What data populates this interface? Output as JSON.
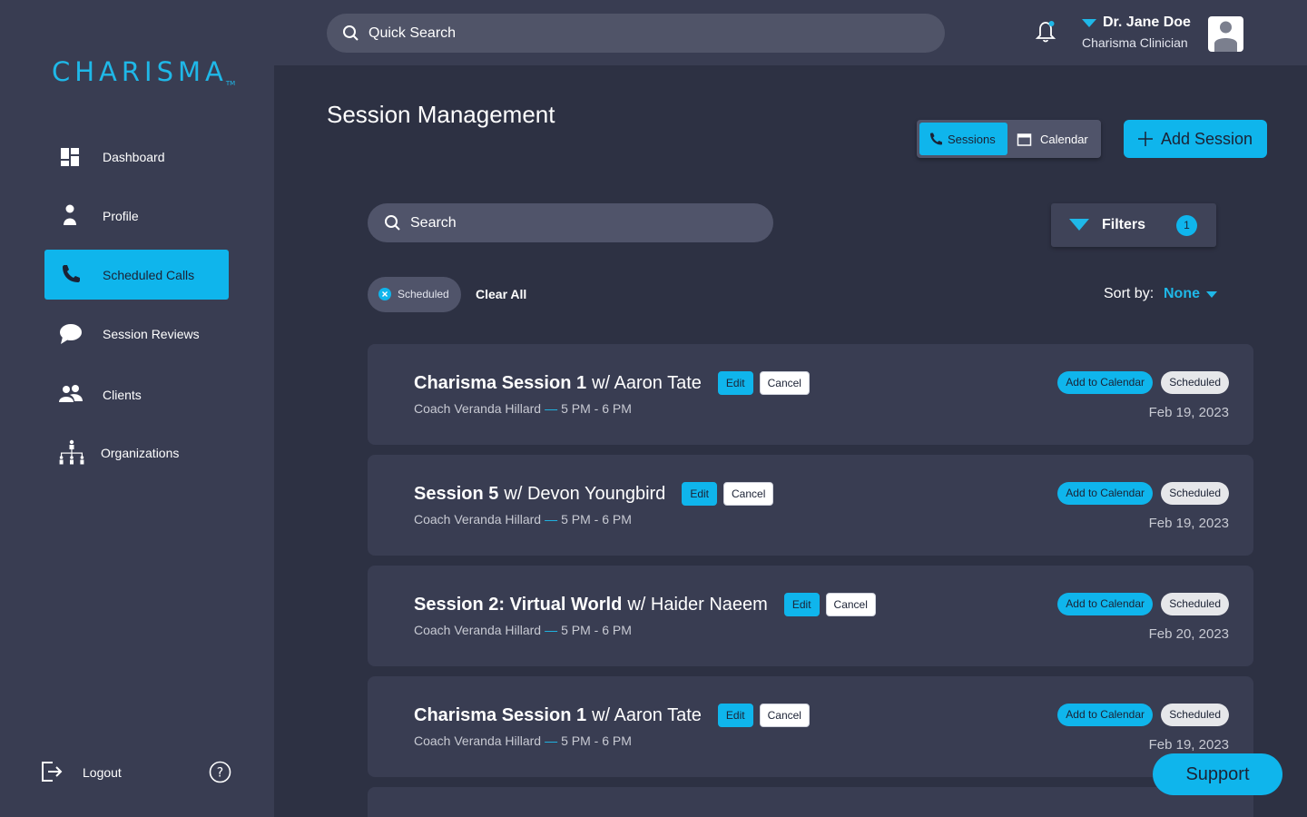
{
  "app": {
    "logo": "CHARISMA",
    "logo_tm": "TM"
  },
  "sidebar": {
    "items": [
      {
        "label": "Dashboard",
        "icon": "dashboard-icon"
      },
      {
        "label": "Profile",
        "icon": "person-icon"
      },
      {
        "label": "Scheduled Calls",
        "icon": "phone-icon",
        "active": true
      },
      {
        "label": "Session Reviews",
        "icon": "chat-bubble-icon"
      },
      {
        "label": "Clients",
        "icon": "group-icon"
      },
      {
        "label": "Organizations",
        "icon": "org-chart-icon"
      }
    ],
    "logout_label": "Logout",
    "help_icon": "question-icon"
  },
  "topbar": {
    "quick_search_placeholder": "Quick Search",
    "user_name": "Dr. Jane Doe",
    "user_role": "Charisma Clinician"
  },
  "main": {
    "title": "Session Management",
    "toggle": {
      "sessions_label": "Sessions",
      "calendar_label": "Calendar"
    },
    "add_session_label": "Add Session",
    "search_placeholder": "Search",
    "filters_label": "Filters",
    "filters_count": "1",
    "chips": [
      {
        "label": "Scheduled"
      }
    ],
    "clear_all_label": "Clear All",
    "sort_label": "Sort by:",
    "sort_value": "None"
  },
  "sessions": [
    {
      "title_bold": "Charisma Session 1",
      "title_with": "w/ Aaron Tate",
      "coach": "Coach Veranda Hillard",
      "dash": "—",
      "time": "5 PM - 6 PM",
      "edit": "Edit",
      "cancel": "Cancel",
      "add_cal": "Add to Calendar",
      "status": "Scheduled",
      "date": "Feb 19, 2023"
    },
    {
      "title_bold": "Session 5",
      "title_with": "w/ Devon Youngbird",
      "coach": "Coach Veranda Hillard",
      "dash": "—",
      "time": "5 PM - 6 PM",
      "edit": "Edit",
      "cancel": "Cancel",
      "add_cal": "Add to Calendar",
      "status": "Scheduled",
      "date": "Feb 19, 2023"
    },
    {
      "title_bold": "Session 2: Virtual World",
      "title_with": "w/ Haider Naeem",
      "coach": "Coach Veranda Hillard",
      "dash": "—",
      "time": "5 PM - 6 PM",
      "edit": "Edit",
      "cancel": "Cancel",
      "add_cal": "Add to Calendar",
      "status": "Scheduled",
      "date": "Feb 20, 2023"
    },
    {
      "title_bold": "Charisma Session 1",
      "title_with": "w/ Aaron Tate",
      "coach": "Coach Veranda Hillard",
      "dash": "—",
      "time": "5 PM - 6 PM",
      "edit": "Edit",
      "cancel": "Cancel",
      "add_cal": "Add to Calendar",
      "status": "Scheduled",
      "date": "Feb 19, 2023"
    }
  ],
  "support_label": "Support",
  "colors": {
    "accent": "#0fb5ec",
    "sidebar_bg": "#393d52",
    "page_bg": "#2d3143",
    "card_bg": "#393d52"
  }
}
